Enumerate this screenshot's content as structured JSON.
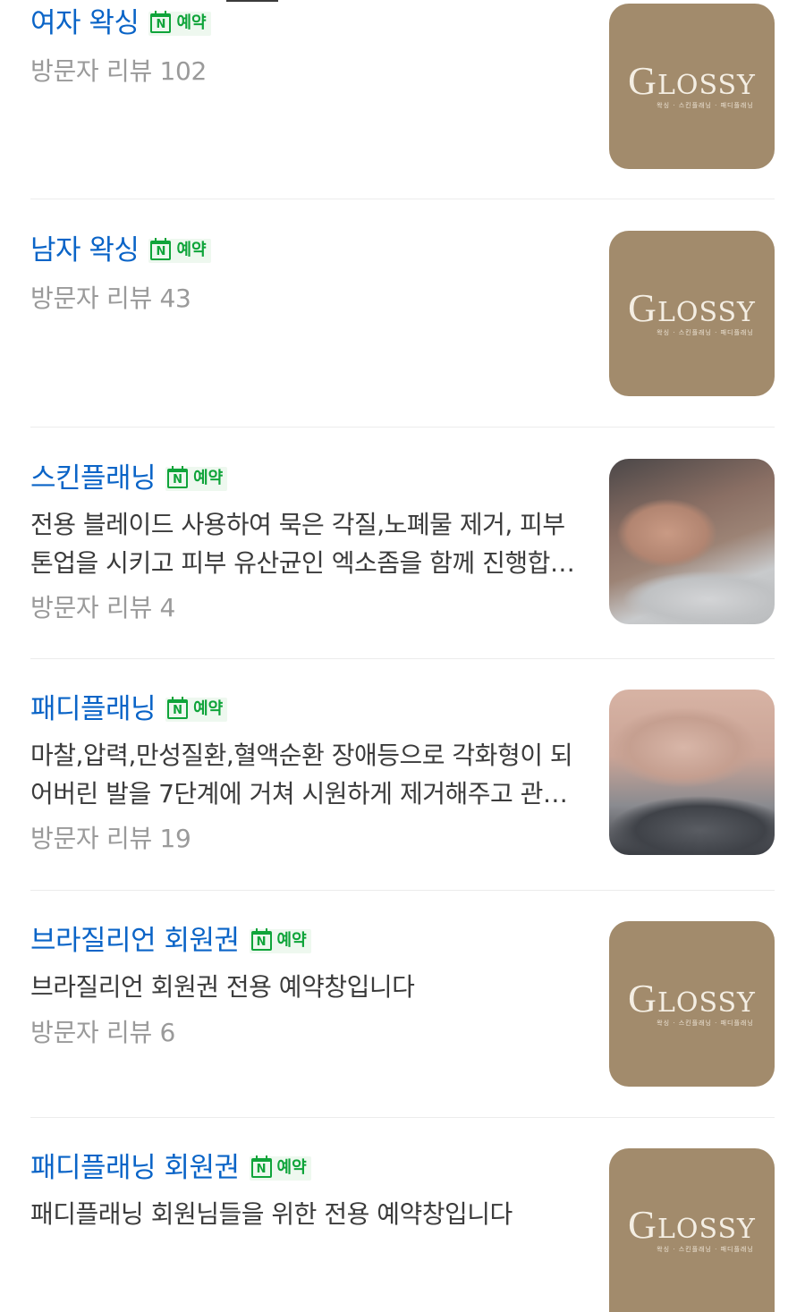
{
  "badge": {
    "icon_letter": "N",
    "label": "예약"
  },
  "logo": {
    "letter": "G",
    "text": "LOSSY",
    "sub": "왁싱 · 스킨플래닝 · 패디플래닝"
  },
  "items": [
    {
      "title": "여자 왁싱",
      "description": "",
      "reviews": "방문자 리뷰 102",
      "thumbnail": "glossy-logo"
    },
    {
      "title": "남자 왁싱",
      "description": "",
      "reviews": "방문자 리뷰 43",
      "thumbnail": "glossy-logo"
    },
    {
      "title": "스킨플래닝",
      "description": "전용 블레이드 사용하여 묵은 각질,노폐물 제거, 피부 톤업을 시키고 피부 유산균인 엑소좀을 함께 진행합니다",
      "reviews": "방문자 리뷰 4",
      "thumbnail": "face-photo"
    },
    {
      "title": "패디플래닝",
      "description": "마찰,압력,만성질환,혈액순환 장애등으로 각화형이 되어버린 발을 7단계에 거쳐 시원하게 제거해주고 관리합니다",
      "reviews": "방문자 리뷰 19",
      "thumbnail": "foot-photo"
    },
    {
      "title": "브라질리언 회원권",
      "description": "브라질리언 회원권 전용 예약창입니다",
      "reviews": "방문자 리뷰 6",
      "thumbnail": "glossy-logo"
    },
    {
      "title": "패디플래닝 회원권",
      "description": "패디플래닝 회원님들을 위한 전용 예약창입니다",
      "reviews": "",
      "thumbnail": "glossy-logo"
    }
  ]
}
